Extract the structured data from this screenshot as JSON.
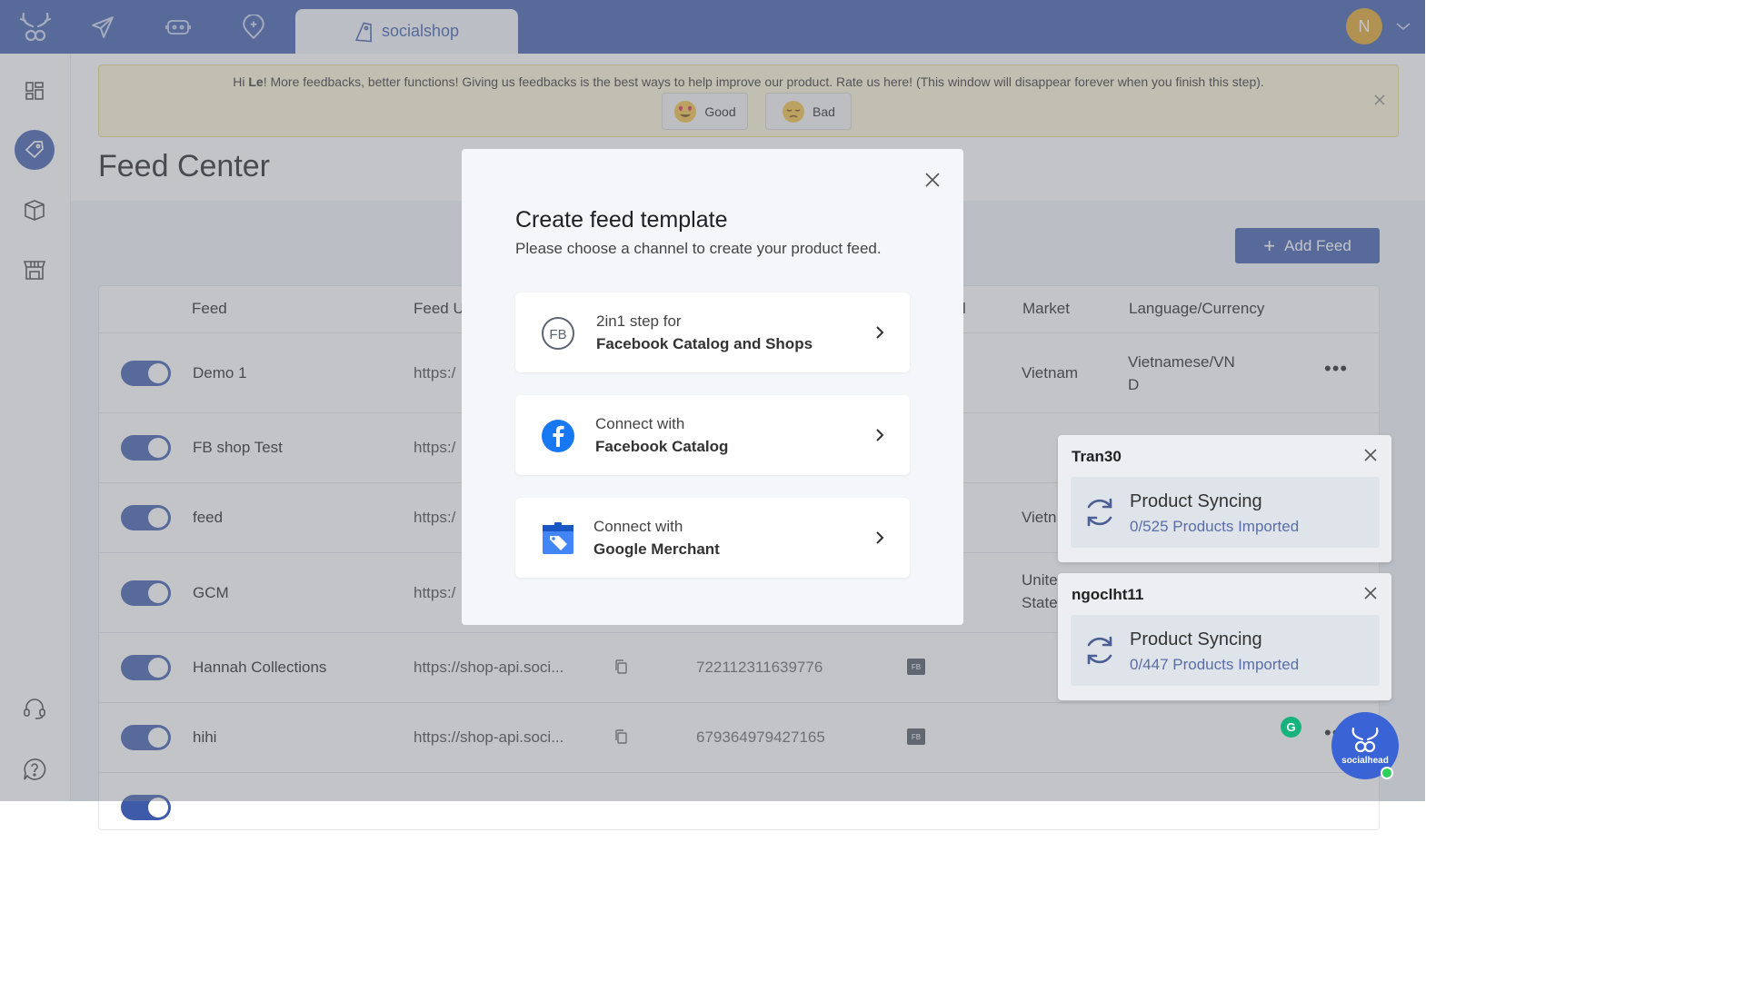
{
  "topbar": {
    "active_tab": "socialshop",
    "avatar_initial": "N"
  },
  "banner": {
    "text_prefix": "Hi ",
    "text_name": "Le",
    "text_suffix": "! More feedbacks, better functions! Giving us feedbacks is the best ways to help improve our product. Rate us here! (This window will disappear forever when you finish this step).",
    "good_label": "Good",
    "bad_label": "Bad"
  },
  "page": {
    "title": "Feed Center",
    "add_feed_label": "Add Feed"
  },
  "table": {
    "headers": {
      "feed": "Feed",
      "feed_url": "Feed U",
      "channel_fragment": "l",
      "market": "Market",
      "language": "Language/Currency"
    },
    "rows": [
      {
        "name": "Demo 1",
        "url": "https:/",
        "id": "",
        "market": "Vietnam",
        "language_line1": "Vietnamese/VN",
        "language_line2": "D"
      },
      {
        "name": "FB shop Test",
        "url": "https:/",
        "id": "",
        "market": "",
        "language_line1": "",
        "language_line2": ""
      },
      {
        "name": "feed",
        "url": "https:/",
        "id": "",
        "market": "Vietn",
        "language_line1": "",
        "language_line2": ""
      },
      {
        "name": "GCM",
        "url": "https:/",
        "id": "",
        "market_line1": "Unite",
        "market_line2": "State"
      },
      {
        "name": "Hannah Collections",
        "url": "https://shop-api.soci...",
        "id": "722112311639776",
        "badge": "FB"
      },
      {
        "name": "hihi",
        "url": "https://shop-api.soci...",
        "id": "679364979427165",
        "badge": "FB"
      }
    ]
  },
  "modal": {
    "title": "Create feed template",
    "subtitle": "Please choose a channel to create your product feed.",
    "options": [
      {
        "line1": "2in1 step for",
        "line2": "Facebook Catalog and Shops",
        "icon": "fb-shops-icon"
      },
      {
        "line1": "Connect with",
        "line2": "Facebook Catalog",
        "icon": "facebook-icon"
      },
      {
        "line1": "Connect with",
        "line2": "Google Merchant",
        "icon": "google-merchant-icon"
      }
    ]
  },
  "sync_panels": [
    {
      "title": "Tran30",
      "heading": "Product Syncing",
      "progress": "0/525 Products Imported"
    },
    {
      "title": "ngoclht11",
      "heading": "Product Syncing",
      "progress": "0/447 Products Imported"
    }
  ],
  "chat": {
    "brand": "socialhead",
    "grammarly_letter": "G"
  },
  "colors": {
    "primary": "#3e5ba9",
    "banner_bg": "#fdf6d8",
    "avatar": "#e0a52a",
    "online": "#2ed15b"
  }
}
